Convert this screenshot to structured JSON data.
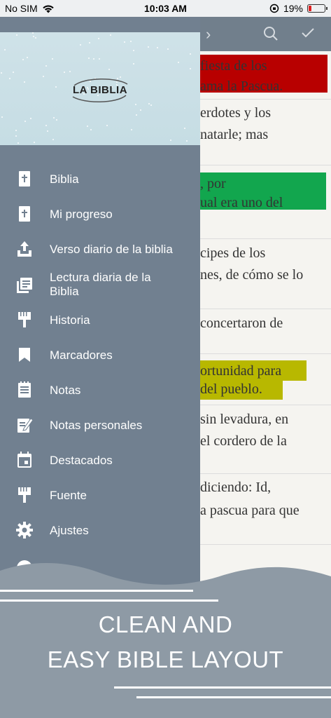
{
  "status_bar": {
    "carrier": "No SIM",
    "time": "10:03 AM",
    "battery_percent": "19%",
    "battery_level": 0.19
  },
  "drawer": {
    "logo_text": "LA BIBLIA",
    "items": [
      {
        "label": "Biblia",
        "icon": "bible-icon"
      },
      {
        "label": "Mi progreso",
        "icon": "bible-icon"
      },
      {
        "label": "Verso diario de la biblia",
        "icon": "upload-tray-icon"
      },
      {
        "label": "Lectura diaria de la Biblia",
        "icon": "library-books-icon"
      },
      {
        "label": "Historia",
        "icon": "brush-icon"
      },
      {
        "label": "Marcadores",
        "icon": "bookmark-icon"
      },
      {
        "label": "Notas",
        "icon": "notes-icon"
      },
      {
        "label": "Notas personales",
        "icon": "edit-note-icon"
      },
      {
        "label": "Destacados",
        "icon": "calendar-icon"
      },
      {
        "label": "Fuente",
        "icon": "brush-icon"
      },
      {
        "label": "Ajustes",
        "icon": "gear-icon"
      }
    ]
  },
  "reader": {
    "verses": [
      "fiesta de los",
      "ama la Pascua.",
      "erdotes y los",
      "natarle; mas",
      ", por",
      "ual era uno del",
      "cipes de los",
      "nes, de cómo se lo",
      " concertaron de",
      "ortunidad para",
      " del pueblo.",
      "sin levadura, en",
      "el cordero de la",
      " diciendo: Id,",
      "a pascua para que"
    ],
    "highlight_colors": {
      "red": "#b80000",
      "green": "#12a64e",
      "yellow": "#b8b800"
    }
  },
  "promo": {
    "line1": "CLEAN AND",
    "line2": "EASY BIBLE LAYOUT",
    "background": "#8e9aa5"
  }
}
